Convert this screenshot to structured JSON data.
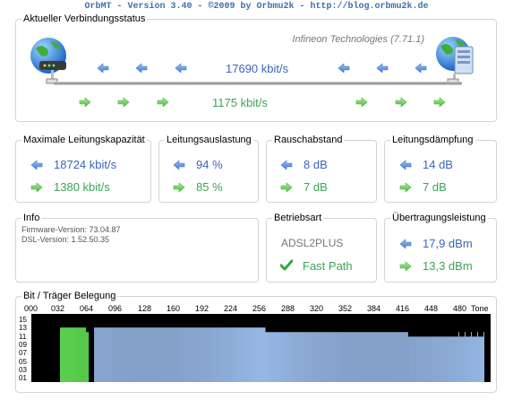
{
  "app_title": "OrbMT - Version 3.40 - ©2009 by Orbmu2k - http://blog.orbmu2k.de",
  "connection": {
    "heading": "Aktueller Verbindungsstatus",
    "chipset": "Infineon Technologies (7.71.1)",
    "down_rate": "17690 kbit/s",
    "up_rate": "1175 kbit/s"
  },
  "max_capacity": {
    "heading": "Maximale Leitungskapazität",
    "down": "18724 kbit/s",
    "up": "1380 kbit/s"
  },
  "utilization": {
    "heading": "Leitungsauslastung",
    "down": "94 %",
    "up": "85 %"
  },
  "snr": {
    "heading": "Rauschabstand",
    "down": "8 dB",
    "up": "7 dB"
  },
  "attenuation": {
    "heading": "Leitungsdämpfung",
    "down": "14 dB",
    "up": "7 dB"
  },
  "info": {
    "heading": "Info",
    "firmware": "Firmware-Version: 73.04.87",
    "dsl": "DSL-Version: 1.52.50.35"
  },
  "mode": {
    "heading": "Betriebsart",
    "standard": "ADSL2PLUS",
    "path": "Fast Path"
  },
  "power": {
    "heading": "Übertragungsleistung",
    "down": "17,9 dBm",
    "up": "13,3 dBm"
  },
  "bitloading": {
    "heading": "Bit / Träger Belegung",
    "x_labels": [
      "000",
      "032",
      "064",
      "096",
      "128",
      "160",
      "192",
      "224",
      "256",
      "288",
      "320",
      "352",
      "384",
      "416",
      "448",
      "480",
      "Tone"
    ],
    "y_labels": [
      "15",
      "13",
      "11",
      "09",
      "07",
      "05",
      "03",
      "01"
    ],
    "colors": {
      "up": "#5fdc52",
      "down": "#97b8e6",
      "background": "#000000"
    }
  },
  "icons": [
    "globe-modem-icon",
    "globe-server-icon",
    "arrow-left-icon",
    "arrow-right-icon",
    "checkmark-icon"
  ]
}
